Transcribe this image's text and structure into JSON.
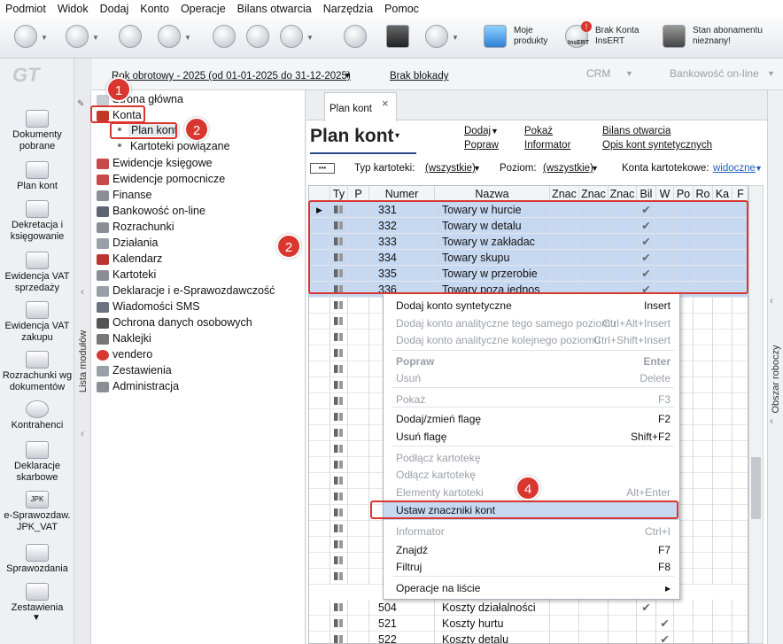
{
  "menu": [
    "Podmiot",
    "Widok",
    "Dodaj",
    "Konto",
    "Operacje",
    "Bilans otwarcia",
    "Narzędzia",
    "Pomoc"
  ],
  "toolbar": {
    "moje_produkty": "Moje produkty",
    "brak_konta": "Brak Konta InsERT",
    "stan_abonamentu": "Stan abonamentu nieznany!",
    "insert_label": "InsERT"
  },
  "ribbon": {
    "rok": "Rok obrotowy - 2025  (od 01-01-2025 do 31-12-2025)",
    "brak_blokady": "Brak blokady",
    "crm": "CRM",
    "bankowosc": "Bankowość on-line"
  },
  "logo": "GT",
  "leftbar": [
    "Dokumenty pobrane",
    "Plan kont",
    "Dekretacja i księgowanie",
    "Ewidencja VAT sprzedaży",
    "Ewidencja VAT zakupu",
    "Rozrachunki wg dokumentów",
    "Kontrahenci",
    "Deklaracje skarbowe",
    "e-Sprawozdaw. JPK_VAT",
    "Sprawozdania",
    "Zestawienia"
  ],
  "jpk_icon_label": "JPK",
  "lista_modulow": "Lista modułów",
  "obszar_roboczy": "Obszar roboczy",
  "tree": {
    "strona_glowna": "Strona główna",
    "konta": "Konta",
    "plan_kont": "Plan kont",
    "kartoteki_powiazane": "Kartoteki powiązane",
    "items": [
      "Ewidencje księgowe",
      "Ewidencje pomocnicze",
      "Finanse",
      "Bankowość on-line",
      "Rozrachunki",
      "Działania",
      "Kalendarz",
      "Kartoteki",
      "Deklaracje i e-Sprawozdawczość",
      "Wiadomości SMS",
      "Ochrona danych osobowych",
      "Naklejki",
      "vendero",
      "Zestawienia",
      "Administracja"
    ]
  },
  "tab": {
    "label": "Plan kont",
    "close": "×"
  },
  "page_title": "Plan kont",
  "actions": {
    "dodaj": "Dodaj",
    "popraw": "Popraw",
    "pokaz": "Pokaż",
    "informator": "Informator",
    "bilans": "Bilans otwarcia",
    "opis": "Opis kont syntetycznych"
  },
  "filters": {
    "more": "•••",
    "typ_label": "Typ kartoteki:",
    "typ_value": "(wszystkie)",
    "poziom_label": "Poziom:",
    "poziom_value": "(wszystkie)",
    "konta_kart_label": "Konta kartotekowe:",
    "konta_kart_value": "widoczne"
  },
  "columns": [
    "Ty",
    "P",
    "Numer",
    "Nazwa",
    "Znac",
    "Znac",
    "Znac",
    "Bil",
    "W",
    "Po",
    "Ro",
    "Ka",
    "F"
  ],
  "rows": [
    {
      "numer": "331",
      "nazwa": "Towary w hurcie"
    },
    {
      "numer": "332",
      "nazwa": "Towary w detalu"
    },
    {
      "numer": "333",
      "nazwa": "Towary w zakładac"
    },
    {
      "numer": "334",
      "nazwa": "Towary skupu"
    },
    {
      "numer": "335",
      "nazwa": "Towary w przerobie"
    },
    {
      "numer": "336",
      "nazwa": "Towary poza jednos"
    }
  ],
  "bottom_rows": [
    {
      "numer": "504",
      "nazwa": "Koszty działalności"
    },
    {
      "numer": "521",
      "nazwa": "Koszty hurtu"
    },
    {
      "numer": "522",
      "nazwa": "Koszty detalu"
    }
  ],
  "check_glyph": "✔",
  "ctx_menu": [
    {
      "label": "Dodaj konto syntetyczne",
      "key": "Insert",
      "enabled": true
    },
    {
      "label": "Dodaj konto analityczne tego samego poziomu",
      "key": "Ctrl+Alt+Insert",
      "enabled": false
    },
    {
      "label": "Dodaj konto analityczne kolejnego poziomu",
      "key": "Ctrl+Shift+Insert",
      "enabled": false
    },
    {
      "label": "Popraw",
      "key": "Enter",
      "enabled": false
    },
    {
      "label": "Usuń",
      "key": "Delete",
      "enabled": false
    },
    {
      "label": "Pokaż",
      "key": "F3",
      "enabled": false
    },
    {
      "label": "Dodaj/zmień flagę",
      "key": "F2",
      "enabled": true
    },
    {
      "label": "Usuń flagę",
      "key": "Shift+F2",
      "enabled": true
    },
    {
      "label": "Podłącz kartotekę",
      "key": "",
      "enabled": false
    },
    {
      "label": "Odłącz kartotekę",
      "key": "",
      "enabled": false
    },
    {
      "label": "Elementy kartoteki",
      "key": "Alt+Enter",
      "enabled": false
    },
    {
      "label": "Ustaw znaczniki kont",
      "key": "",
      "enabled": true
    },
    {
      "label": "Informator",
      "key": "Ctrl+I",
      "enabled": false
    },
    {
      "label": "Znajdź",
      "key": "F7",
      "enabled": true
    },
    {
      "label": "Filtruj",
      "key": "F8",
      "enabled": true
    },
    {
      "label": "Operacje na liście",
      "key": "▸",
      "enabled": true
    }
  ],
  "badges": [
    "1",
    "2",
    "2",
    "4"
  ]
}
